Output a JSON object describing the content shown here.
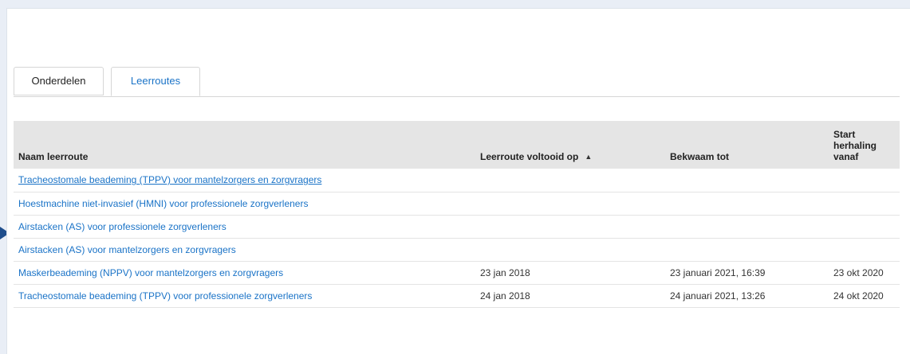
{
  "tabs": [
    {
      "label": "Onderdelen",
      "active": false
    },
    {
      "label": "Leerroutes",
      "active": true
    }
  ],
  "table": {
    "headers": {
      "name": "Naam leerroute",
      "completed": "Leerroute voltooid op",
      "competent_until": "Bekwaam tot",
      "repeat_from": "Start herhaling vanaf"
    },
    "sort_indicator": "▲",
    "rows": [
      {
        "name": "Tracheostomale beademing (TPPV) voor mantelzorgers en zorgvragers",
        "completed": "",
        "competent_until": "",
        "repeat_from": ""
      },
      {
        "name": "Hoestmachine niet-invasief (HMNI) voor professionele zorgverleners",
        "completed": "",
        "competent_until": "",
        "repeat_from": ""
      },
      {
        "name": "Airstacken (AS) voor professionele zorgverleners",
        "completed": "",
        "competent_until": "",
        "repeat_from": ""
      },
      {
        "name": "Airstacken (AS) voor mantelzorgers en zorgvragers",
        "completed": "",
        "competent_until": "",
        "repeat_from": ""
      },
      {
        "name": "Maskerbeademing (NPPV) voor mantelzorgers en zorgvragers",
        "completed": "23 jan 2018",
        "competent_until": "23 januari 2021, 16:39",
        "repeat_from": "23 okt 2020"
      },
      {
        "name": "Tracheostomale beademing (TPPV) voor professionele zorgverleners",
        "completed": "24 jan 2018",
        "competent_until": "24 januari 2021, 13:26",
        "repeat_from": "24 okt 2020"
      }
    ]
  },
  "colors": {
    "link": "#1a73c7",
    "header_bg": "#e5e5e5",
    "marker": "#1f4e8c"
  }
}
